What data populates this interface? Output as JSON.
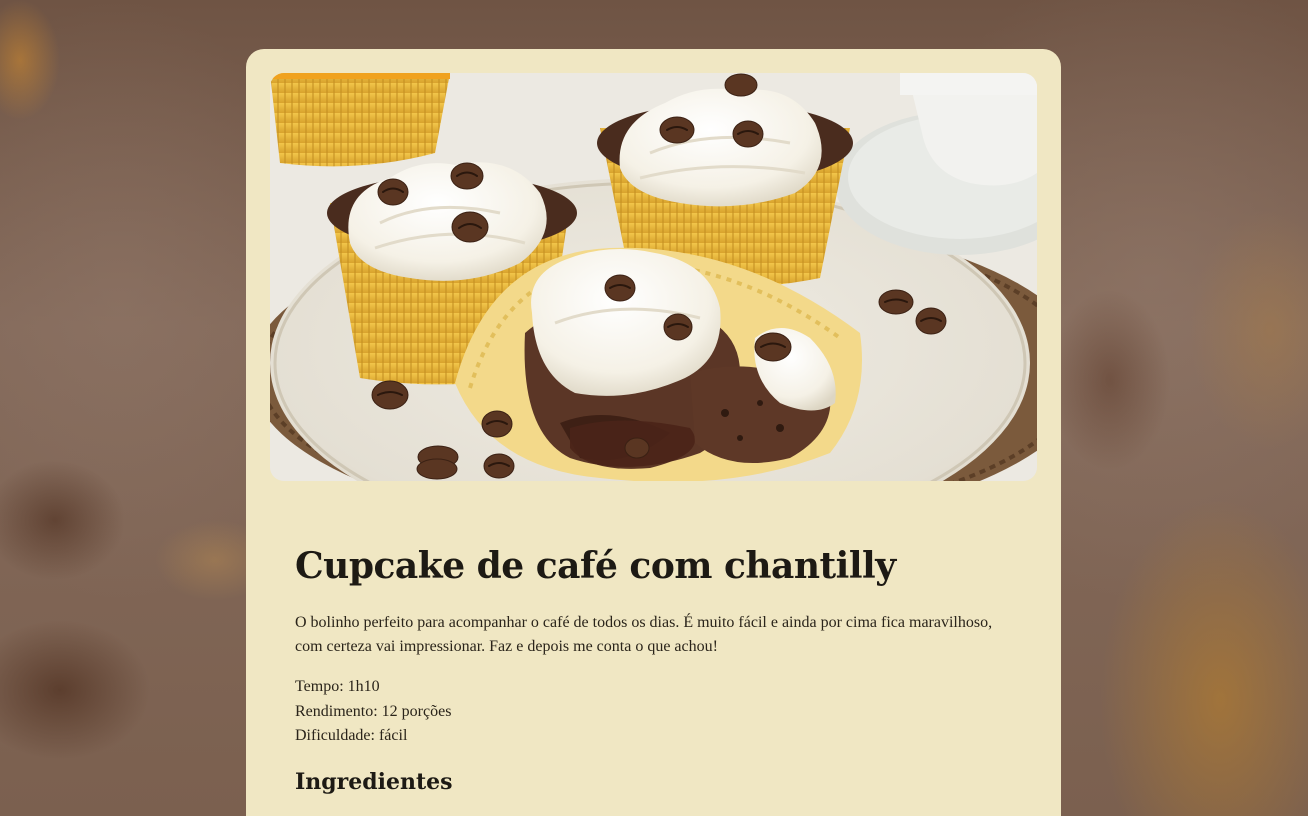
{
  "recipe": {
    "title": "Cupcake de café com chantilly",
    "description": "O bolinho perfeito para acompanhar o café de todos os dias. É muito fácil e ainda por cima fica maravilhoso, com certeza vai impressionar. Faz e depois me conta o que achou!",
    "meta": {
      "time": "Tempo: 1h10",
      "yield": "Rendimento: 12 porções",
      "difficulty": "Dificuldade: fácil"
    },
    "sections": {
      "ingredients_title": "Ingredientes"
    }
  },
  "colors": {
    "card_background": "#f0e7c3",
    "page_background": "#7a5f4e",
    "text": "#1d1a14"
  }
}
